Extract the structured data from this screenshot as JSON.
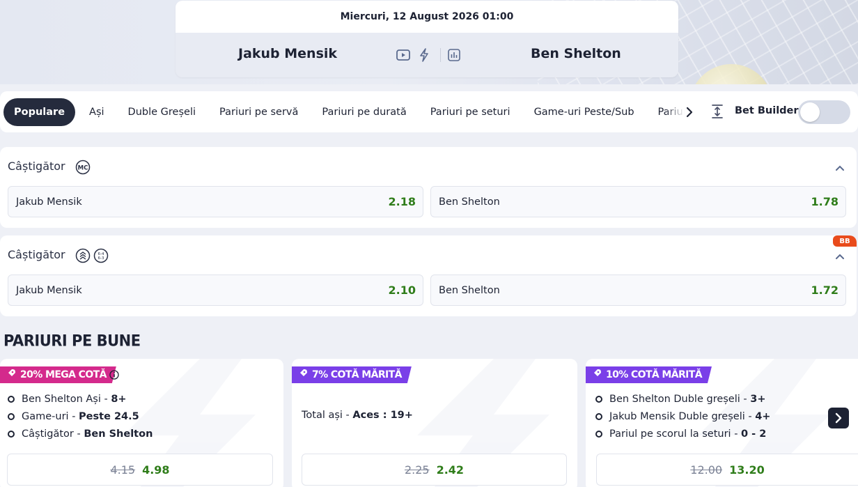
{
  "match": {
    "date": "Miercuri, 12 August 2026 01:00",
    "home": "Jakub Mensik",
    "away": "Ben Shelton"
  },
  "tabs": [
    {
      "label": "Populare",
      "active": true
    },
    {
      "label": "Ași"
    },
    {
      "label": "Duble Greșeli"
    },
    {
      "label": "Pariuri pe servă"
    },
    {
      "label": "Pariuri pe durată"
    },
    {
      "label": "Pariuri pe seturi"
    },
    {
      "label": "Game-uri Peste/Sub"
    },
    {
      "label": "Pariuri Handicap"
    }
  ],
  "bet_builder": {
    "label": "Bet Builder",
    "enabled": false
  },
  "markets": [
    {
      "title": "Câștigător",
      "badge": "",
      "outcomes": [
        {
          "label": "Jakub Mensik",
          "odd": "2.18"
        },
        {
          "label": "Ben Shelton",
          "odd": "1.78"
        }
      ]
    },
    {
      "title": "Câștigător",
      "badge": "BB",
      "outcomes": [
        {
          "label": "Jakub Mensik",
          "odd": "2.10"
        },
        {
          "label": "Ben Shelton",
          "odd": "1.72"
        }
      ]
    }
  ],
  "section_title": "PARIURI PE BUNE",
  "promos": [
    {
      "badge": "20% MEGA COTĂ",
      "badge_color": "#d42a8c",
      "selections": [
        {
          "text": "Ben Shelton Ași",
          "sep": " - ",
          "value": "8+"
        },
        {
          "text": "Game-uri",
          "sep": " - ",
          "value": "Peste 24.5"
        },
        {
          "text": "Câștigător",
          "sep": " - ",
          "value": "Ben Shelton"
        }
      ],
      "old_odd": "4.15",
      "new_odd": "4.98"
    },
    {
      "badge": "7% COTĂ MĂRITĂ",
      "badge_color": "#7a3fe8",
      "selections": [
        {
          "text": "Total ași",
          "sep": " - ",
          "value": "Aces : 19+"
        }
      ],
      "old_odd": "2.25",
      "new_odd": "2.42"
    },
    {
      "badge": "10% COTĂ MĂRITĂ",
      "badge_color": "#7a3fe8",
      "selections": [
        {
          "text": "Ben Shelton Duble greșeli",
          "sep": " - ",
          "value": "3+"
        },
        {
          "text": "Jakub Mensik Duble greșeli",
          "sep": " - ",
          "value": "4+"
        },
        {
          "text": "Pariul pe scorul la seturi",
          "sep": " - ",
          "value": "0 - 2"
        }
      ],
      "old_odd": "12.00",
      "new_odd": "13.20"
    }
  ],
  "colors": {
    "odd_green": "#2f7d1a",
    "dark": "#1d2233",
    "bb_orange": "#e94b1b"
  }
}
